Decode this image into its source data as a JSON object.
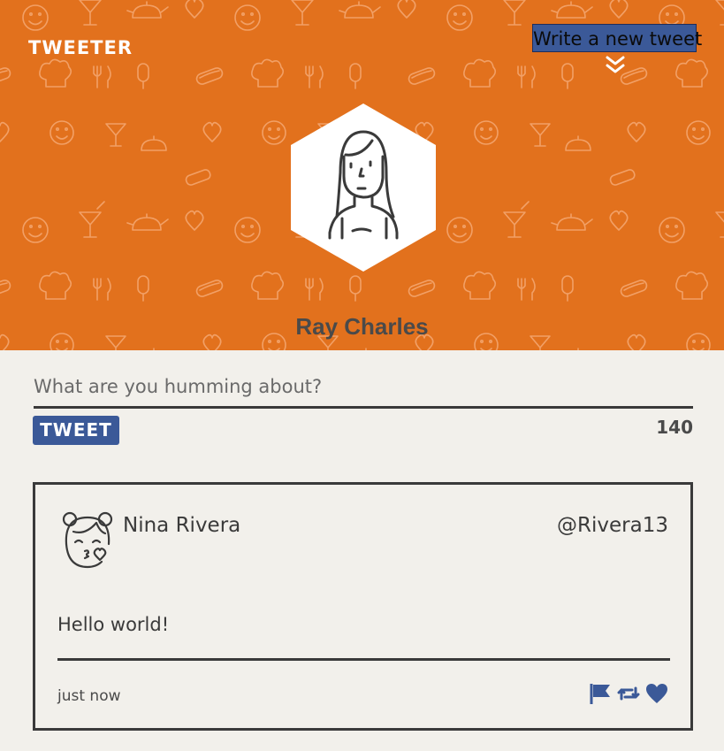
{
  "header": {
    "logo": "TWEETER",
    "compose_link": "Write a new tweet",
    "background_color": "#e2711d",
    "profile": {
      "name": "Ray Charles",
      "avatar_icon": "woman-portrait-icon"
    }
  },
  "composer": {
    "placeholder": "What are you humming about?",
    "value": "",
    "tweet_button": "TWEET",
    "char_count": "140",
    "accent_color": "#3b5998"
  },
  "tweets": [
    {
      "name": "Nina Rivera",
      "handle": "@Rivera13",
      "text": "Hello world!",
      "time": "just now",
      "avatar_icon": "girl-blowing-kiss-icon",
      "actions": [
        "flag-icon",
        "retweet-icon",
        "heart-icon"
      ]
    }
  ]
}
